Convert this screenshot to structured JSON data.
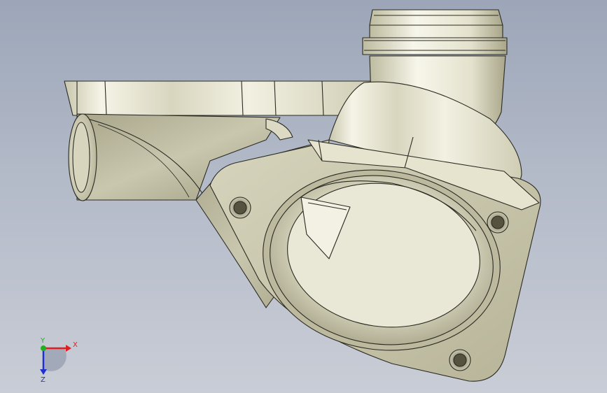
{
  "triad": {
    "x_label": "X",
    "y_label": "Y",
    "z_label": "Z",
    "colors": {
      "x": "#e02020",
      "y": "#20b020",
      "z": "#2030d0"
    }
  },
  "palette": {
    "metal_light": "#ecebdb",
    "metal_mid": "#c9c7ae",
    "metal_dark": "#8f8c72",
    "edge": "#2a2a22",
    "background_top": "#9ca6b8",
    "background_bottom": "#c9cdd6"
  },
  "icons": {
    "triad": "coordinate-triad-icon"
  }
}
